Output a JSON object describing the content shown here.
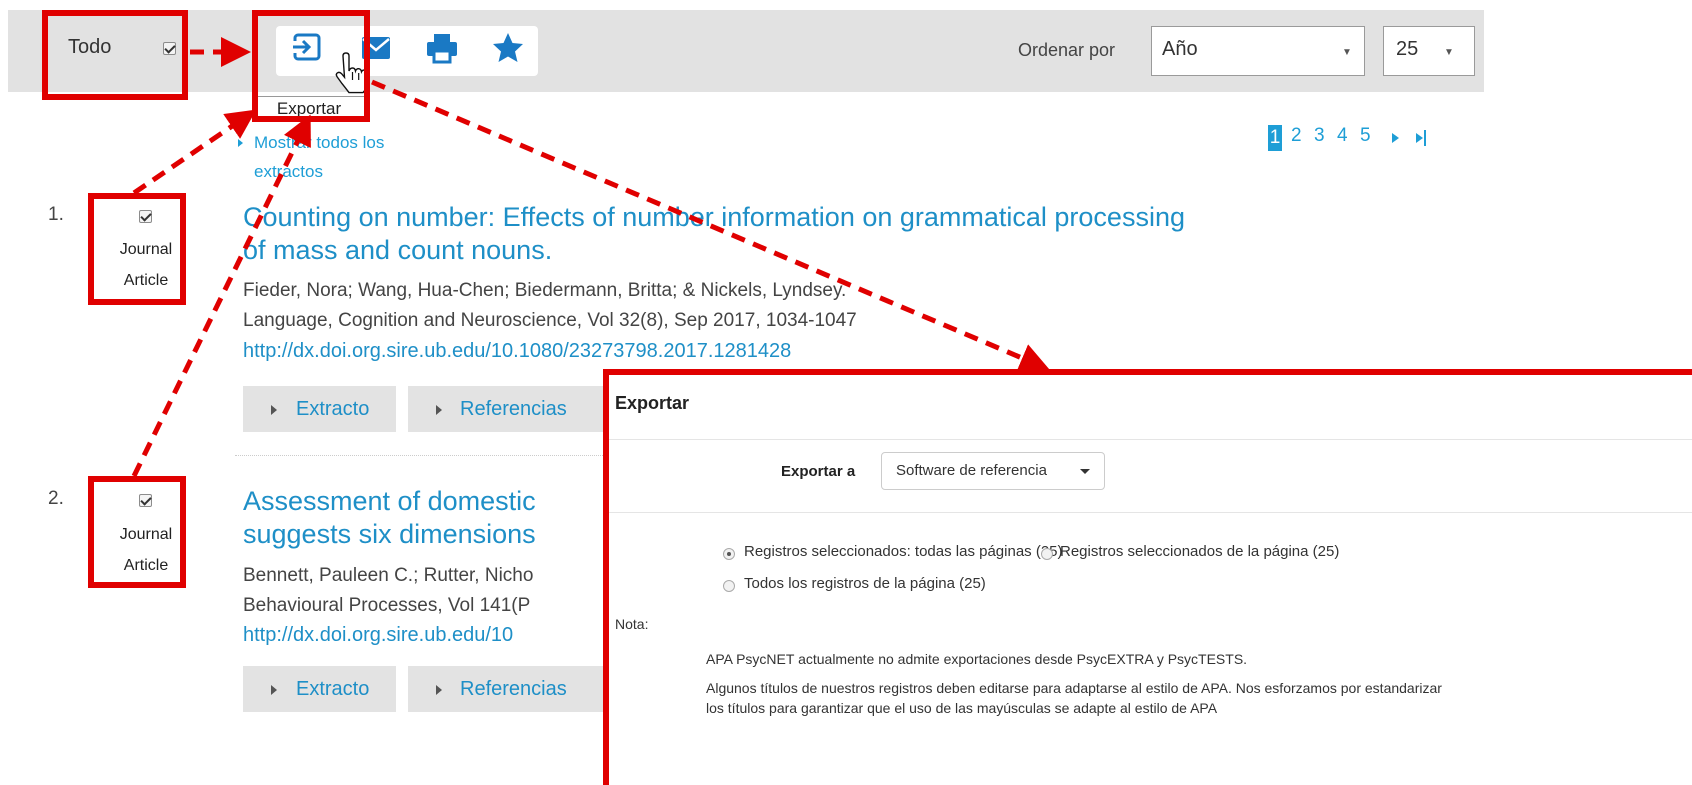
{
  "toolbar": {
    "select_all_label": "Todo",
    "tooltip": "Exportar",
    "sort_label": "Ordenar por",
    "sort_value": "Año",
    "per_page_value": "25",
    "icons": [
      "export-icon",
      "email-icon",
      "print-icon",
      "star-icon"
    ]
  },
  "show_all_abstracts": [
    "Mostrar todos los",
    "extractos"
  ],
  "pagination": {
    "current": "1",
    "pages": [
      "2",
      "3",
      "4",
      "5"
    ]
  },
  "results": [
    {
      "number": "1.",
      "type_line1": "Journal",
      "type_line2": "Article",
      "title_line1": "Counting on number: Effects of number information on grammatical processing",
      "title_line2": "of mass and count nouns.",
      "authors": "Fieder, Nora; Wang, Hua-Chen; Biedermann, Britta; & Nickels, Lyndsey.",
      "source": "Language, Cognition and Neuroscience, Vol 32(8), Sep 2017, 1034-1047",
      "doi": "http://dx.doi.org.sire.ub.edu/10.1080/23273798.2017.1281428",
      "btn_abstract": "Extracto",
      "btn_refs": "Referencias"
    },
    {
      "number": "2.",
      "type_line1": "Journal",
      "type_line2": "Article",
      "title_line1": "Assessment of domestic",
      "title_line2": "suggests six dimensions",
      "authors": "Bennett, Pauleen C.; Rutter, Nicho",
      "source": "Behavioural Processes, Vol 141(P",
      "doi": "http://dx.doi.org.sire.ub.edu/10",
      "btn_abstract": "Extracto",
      "btn_refs": "Referencias"
    }
  ],
  "modal": {
    "title": "Exportar",
    "export_to_label": "Exportar a",
    "export_to_value": "Software de referencia",
    "options": [
      "Registros seleccionados: todas las páginas (25)",
      "Registros seleccionados de la página (25)",
      "Todos los registros de la página (25)"
    ],
    "note_label": "Nota:",
    "note_1": "APA PsycNET actualmente no admite exportaciones desde PsycEXTRA y PsycTESTS.",
    "note_2a": "Algunos títulos de nuestros registros deben editarse para adaptarse al estilo de APA. Nos esforzamos por estandarizar",
    "note_2b": "los títulos para garantizar que el uso de las mayúsculas se adapte al estilo de APA"
  },
  "colors": {
    "link": "#1e9ed6",
    "highlight": "#e00000",
    "toolbar_bg": "#e2e2e2"
  }
}
